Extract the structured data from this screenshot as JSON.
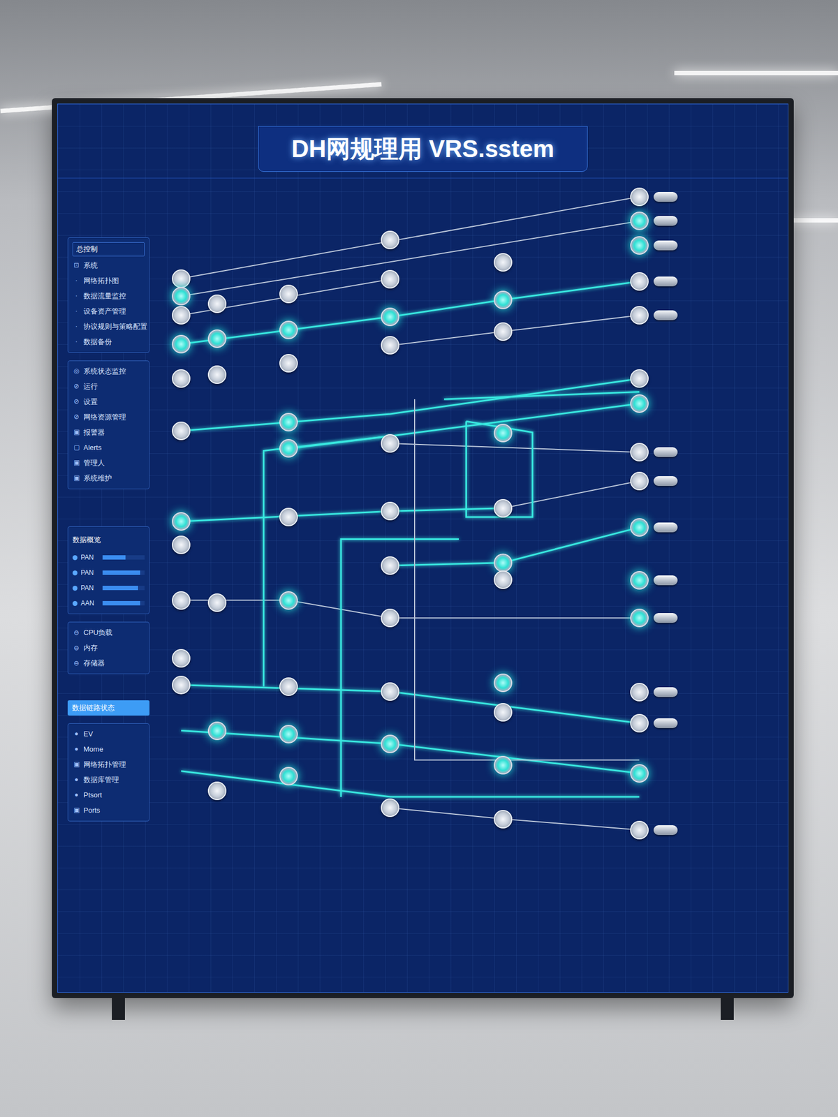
{
  "window": {
    "title": "DH网规理用 VRS.sstem"
  },
  "sidebar": {
    "menu": {
      "header": "总控制",
      "items": [
        {
          "icon": "⊡",
          "label": "系统"
        },
        {
          "icon": "·",
          "label": "网络拓扑图"
        },
        {
          "icon": "·",
          "label": "数据流量监控"
        },
        {
          "icon": "·",
          "label": "设备资产管理"
        },
        {
          "icon": "·",
          "label": "协议规则与策略配置"
        },
        {
          "icon": "·",
          "label": "数据备份"
        }
      ]
    },
    "status": {
      "items": [
        {
          "icon": "◎",
          "label": "系统状态监控"
        },
        {
          "icon": "⊘",
          "label": "运行"
        },
        {
          "icon": "⊘",
          "label": "设置"
        },
        {
          "icon": "⊘",
          "label": "网络资源管理"
        },
        {
          "icon": "▣",
          "label": "报警器"
        },
        {
          "icon": "▢",
          "label": "Alerts"
        },
        {
          "icon": "▣",
          "label": "管理人"
        },
        {
          "icon": "▣",
          "label": "系统维护"
        }
      ]
    },
    "overview": {
      "header": "数据概览",
      "bars": [
        {
          "label": "PAN",
          "level": 0.55
        },
        {
          "label": "PAN",
          "level": 0.9
        },
        {
          "label": "PAN",
          "level": 0.85
        },
        {
          "label": "AAN",
          "level": 0.9
        }
      ]
    },
    "resources": {
      "items": [
        {
          "icon": "⊖",
          "label": "CPU负载"
        },
        {
          "icon": "⊖",
          "label": "内存"
        },
        {
          "icon": "⊖",
          "label": "存储器"
        }
      ]
    },
    "link_button": {
      "label": "数据链路状态",
      "selected": true
    },
    "tools": {
      "items": [
        {
          "icon": "●",
          "label": "EV"
        },
        {
          "icon": "●",
          "label": "Mome"
        },
        {
          "icon": "▣",
          "label": "网络拓扑管理"
        },
        {
          "icon": "●",
          "label": "数据库管理"
        },
        {
          "icon": "●",
          "label": "Ptsort"
        },
        {
          "icon": "▣",
          "label": "Ports"
        }
      ]
    }
  },
  "diagram": {
    "columns": [
      {
        "nodes": [
          {
            "active": false,
            "kind": "node"
          },
          {
            "active": true,
            "kind": "node"
          },
          {
            "active": false,
            "kind": "node"
          },
          {
            "active": true,
            "kind": "node"
          },
          {
            "active": false,
            "kind": "node"
          },
          {
            "active": false,
            "kind": "node"
          },
          {
            "active": true,
            "kind": "node"
          },
          {
            "active": false,
            "kind": "node"
          },
          {
            "active": false,
            "kind": "node"
          },
          {
            "active": false,
            "kind": "node"
          },
          {
            "active": false,
            "kind": "node"
          }
        ]
      },
      {
        "nodes": [
          {
            "active": false,
            "kind": "node"
          },
          {
            "active": true,
            "kind": "node"
          },
          {
            "active": false,
            "kind": "node"
          },
          {
            "active": false,
            "kind": "node"
          },
          {
            "active": true,
            "kind": "node"
          },
          {
            "active": false,
            "kind": "node"
          }
        ]
      },
      {
        "nodes": [
          {
            "active": false,
            "kind": "node"
          },
          {
            "active": true,
            "kind": "node"
          },
          {
            "active": false,
            "kind": "node"
          },
          {
            "active": true,
            "kind": "node"
          },
          {
            "active": true,
            "kind": "node"
          },
          {
            "active": false,
            "kind": "node"
          },
          {
            "active": true,
            "kind": "node"
          },
          {
            "active": false,
            "kind": "node"
          },
          {
            "active": true,
            "kind": "node"
          },
          {
            "active": true,
            "kind": "node"
          }
        ]
      },
      {
        "nodes": [
          {
            "active": false,
            "kind": "node"
          },
          {
            "active": false,
            "kind": "node"
          },
          {
            "active": true,
            "kind": "node"
          },
          {
            "active": false,
            "kind": "node"
          },
          {
            "active": false,
            "kind": "node"
          },
          {
            "active": false,
            "kind": "node"
          },
          {
            "active": false,
            "kind": "node"
          },
          {
            "active": false,
            "kind": "node"
          },
          {
            "active": false,
            "kind": "node"
          },
          {
            "active": true,
            "kind": "node"
          },
          {
            "active": false,
            "kind": "node"
          }
        ]
      },
      {
        "nodes": [
          {
            "active": false,
            "kind": "node"
          },
          {
            "active": true,
            "kind": "node"
          },
          {
            "active": false,
            "kind": "node"
          },
          {
            "active": true,
            "kind": "node"
          },
          {
            "active": false,
            "kind": "node"
          },
          {
            "active": true,
            "kind": "node"
          },
          {
            "active": false,
            "kind": "node"
          },
          {
            "active": true,
            "kind": "node"
          },
          {
            "active": false,
            "kind": "node"
          },
          {
            "active": true,
            "kind": "node"
          },
          {
            "active": false,
            "kind": "node"
          }
        ]
      },
      {
        "nodes": [
          {
            "active": false,
            "kind": "terminal"
          },
          {
            "active": true,
            "kind": "terminal"
          },
          {
            "active": true,
            "kind": "terminal"
          },
          {
            "active": false,
            "kind": "terminal"
          },
          {
            "active": false,
            "kind": "terminal"
          },
          {
            "active": false,
            "kind": "node"
          },
          {
            "active": true,
            "kind": "node"
          },
          {
            "active": false,
            "kind": "terminal"
          },
          {
            "active": false,
            "kind": "terminal"
          },
          {
            "active": true,
            "kind": "terminal"
          },
          {
            "active": true,
            "kind": "terminal"
          },
          {
            "active": true,
            "kind": "terminal"
          },
          {
            "active": false,
            "kind": "terminal"
          },
          {
            "active": false,
            "kind": "terminal"
          },
          {
            "active": true,
            "kind": "node"
          },
          {
            "active": false,
            "kind": "terminal"
          }
        ]
      }
    ],
    "links": [
      {
        "active": true
      },
      {
        "active": true
      },
      {
        "active": true
      },
      {
        "active": true
      },
      {
        "active": true
      },
      {
        "active": true
      },
      {
        "active": false
      },
      {
        "active": false
      },
      {
        "active": true
      },
      {
        "active": false
      },
      {
        "active": true
      },
      {
        "active": false
      },
      {
        "active": true
      },
      {
        "active": true
      },
      {
        "active": false
      },
      {
        "active": true
      },
      {
        "active": false
      },
      {
        "active": true
      },
      {
        "active": false
      },
      {
        "active": true
      },
      {
        "active": true
      },
      {
        "active": true
      },
      {
        "active": false
      },
      {
        "active": true
      },
      {
        "active": true
      },
      {
        "active": true
      },
      {
        "active": false
      },
      {
        "active": true
      }
    ]
  }
}
